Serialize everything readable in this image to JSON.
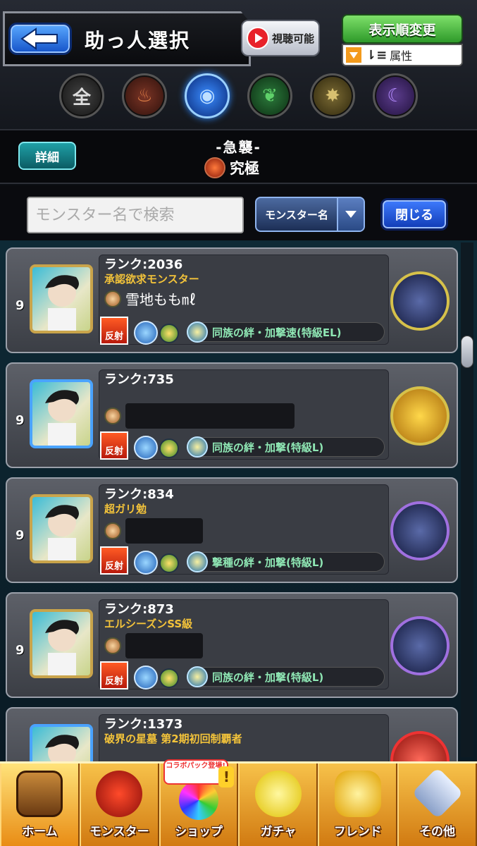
{
  "header": {
    "title": "助っ人選択",
    "view_label": "視聴可能",
    "sort_label": "表示順変更",
    "sort_sub_label": "属性"
  },
  "elements": [
    "全",
    "",
    "",
    "",
    "",
    ""
  ],
  "quest": {
    "detail_label": "詳細",
    "name": "-急襲-",
    "rank": "究極"
  },
  "search": {
    "placeholder": "モンスター名で検索",
    "select_value": "モンスター名",
    "close_label": "閉じる"
  },
  "cards": [
    {
      "level": "9",
      "rank": "ランク:2036",
      "title": "承認欲求モンスター",
      "name": "雪地もも㎖",
      "bond": "同族の絆・加撃速(特級EL)",
      "reflect": "反射"
    },
    {
      "level": "9",
      "rank": "ランク:735",
      "title": "",
      "name": "",
      "bond": "同族の絆・加撃(特級L)",
      "reflect": "反射"
    },
    {
      "level": "9",
      "rank": "ランク:834",
      "title": "超ガリ勉",
      "name": "",
      "bond": "撃種の絆・加撃(特級L)",
      "reflect": "反射"
    },
    {
      "level": "9",
      "rank": "ランク:873",
      "title": "エルシーズンSS級",
      "name": "",
      "bond": "同族の絆・加撃(特級L)",
      "reflect": "反射"
    },
    {
      "level": "",
      "rank": "ランク:1373",
      "title": "破界の星墓 第2期初回制覇者",
      "name": "",
      "bond": "",
      "reflect": ""
    }
  ],
  "nav": {
    "home": "ホーム",
    "monster": "モンスター",
    "shop": "ショップ",
    "shop_badge": "コラボパック登場!",
    "shop_alert": "!",
    "gacha": "ガチャ",
    "friend": "フレンド",
    "other": "その他"
  }
}
